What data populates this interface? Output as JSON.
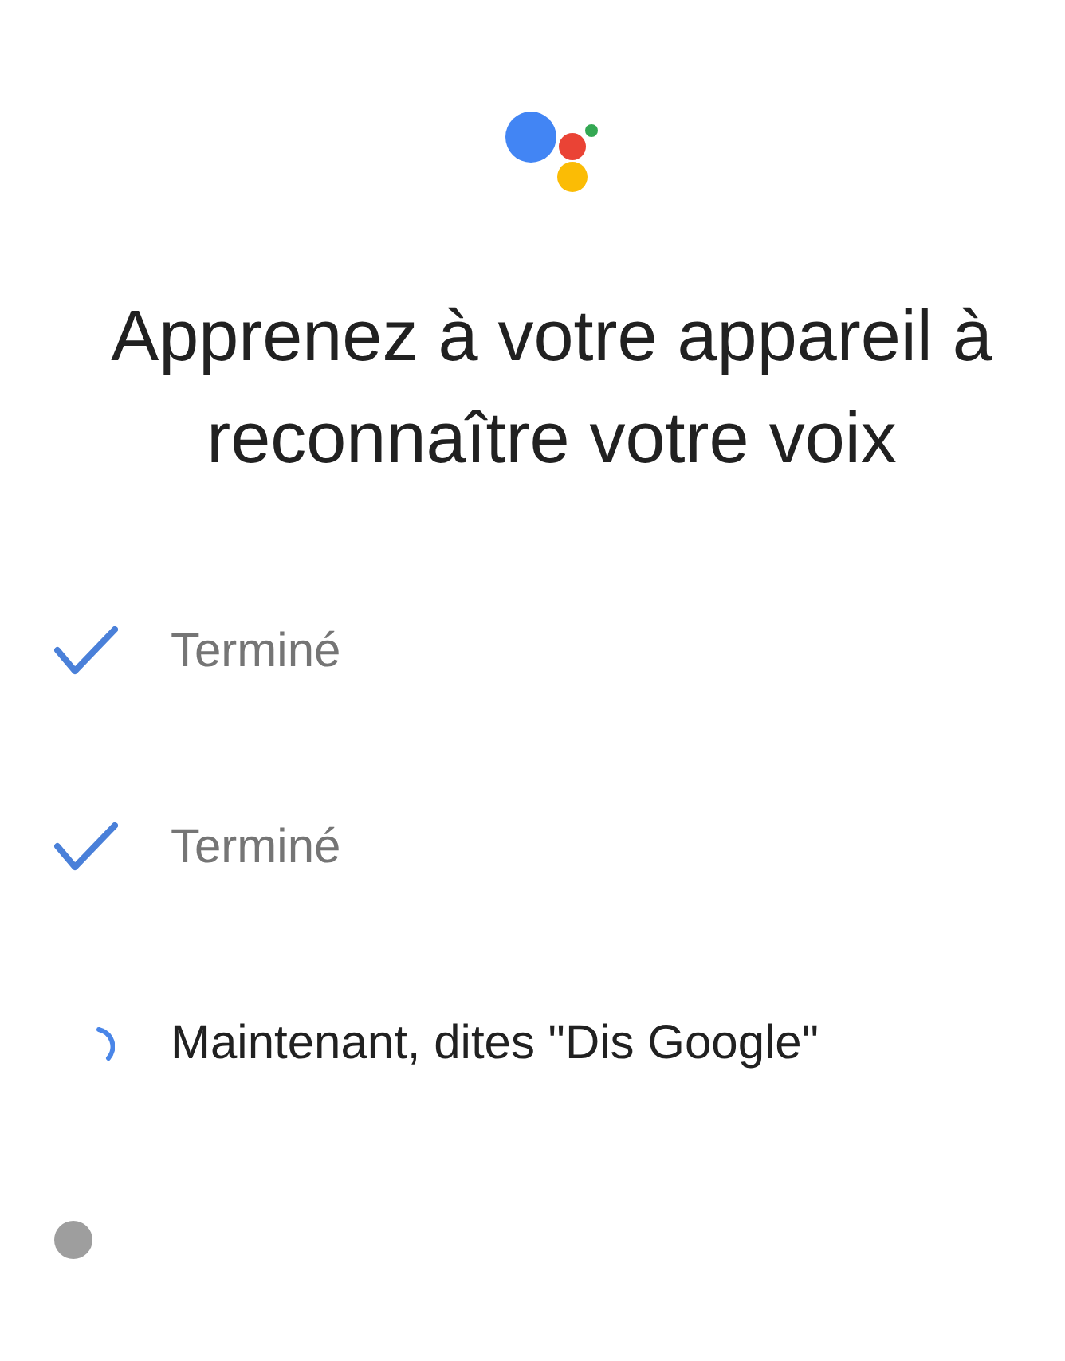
{
  "title": "Apprenez à votre appareil à reconnaître votre voix",
  "steps": [
    {
      "kind": "done",
      "label": "Terminé"
    },
    {
      "kind": "done",
      "label": "Terminé"
    },
    {
      "kind": "in_progress",
      "label": "Maintenant, dites \"Dis Google\""
    },
    {
      "kind": "pending"
    }
  ]
}
